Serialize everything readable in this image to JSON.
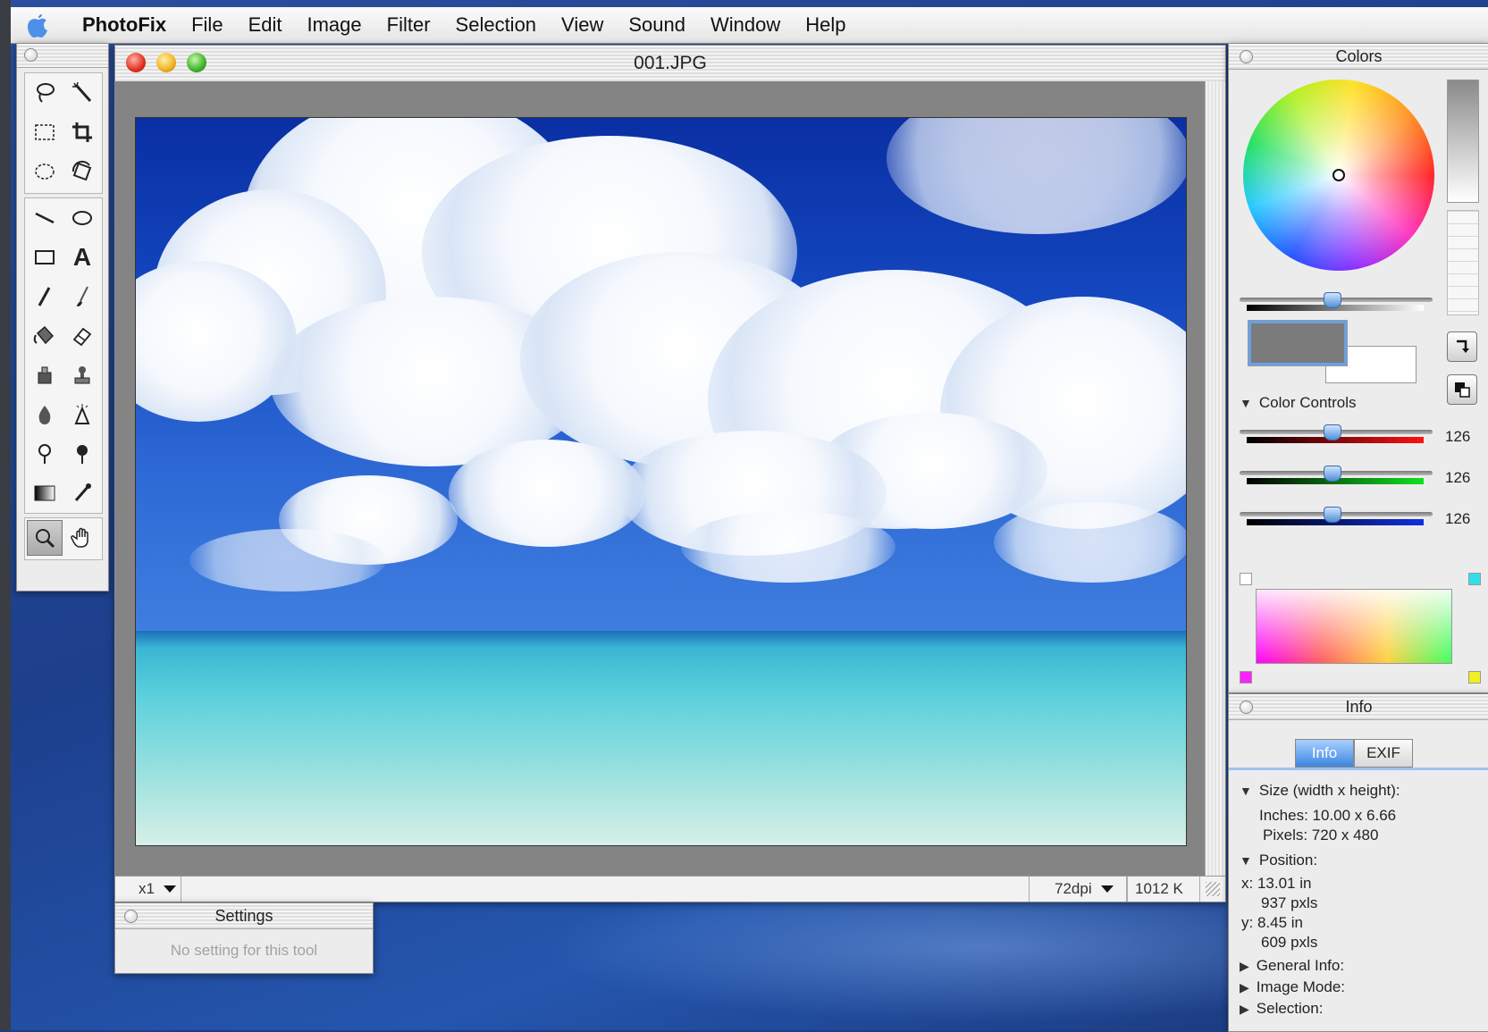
{
  "menubar": {
    "app_name": "PhotoFix",
    "items": [
      "File",
      "Edit",
      "Image",
      "Filter",
      "Selection",
      "View",
      "Sound",
      "Window",
      "Help"
    ]
  },
  "document": {
    "title": "001.JPG",
    "zoom": "x1",
    "resolution": "72dpi",
    "file_size": "1012 K"
  },
  "settings": {
    "title": "Settings",
    "message": "No setting for this tool"
  },
  "colors": {
    "title": "Colors",
    "color_controls_label": "Color Controls",
    "red_value": "126",
    "green_value": "126",
    "blue_value": "126",
    "foreground_color": "#7b7b7b",
    "background_color": "#ffffff"
  },
  "info": {
    "title": "Info",
    "tabs": [
      "Info",
      "EXIF"
    ],
    "active_tab": "Info",
    "size_header": "Size (width x height):",
    "inches": "Inches: 10.00 x 6.66",
    "pixels": "Pixels: 720 x 480",
    "position_header": "Position:",
    "x_in": "x: 13.01 in",
    "x_px": "937 pxls",
    "y_in": "y: 8.45 in",
    "y_px": "609 pxls",
    "general_info": "General Info:",
    "image_mode": "Image Mode:",
    "selection": "Selection:"
  },
  "tools": [
    "lasso-icon",
    "magic-wand-icon",
    "rect-select-icon",
    "crop-icon",
    "ellipse-select-icon",
    "rotate-icon",
    "line-icon",
    "ellipse-icon",
    "rectangle-icon",
    "text-icon",
    "pencil-icon",
    "brush-icon",
    "paint-bucket-icon",
    "eraser-icon",
    "clone-icon",
    "stamp-icon",
    "blur-icon",
    "sharpen-icon",
    "dodge-icon",
    "burn-icon",
    "gradient-icon",
    "eyedropper-icon",
    "zoom-icon",
    "hand-icon"
  ]
}
